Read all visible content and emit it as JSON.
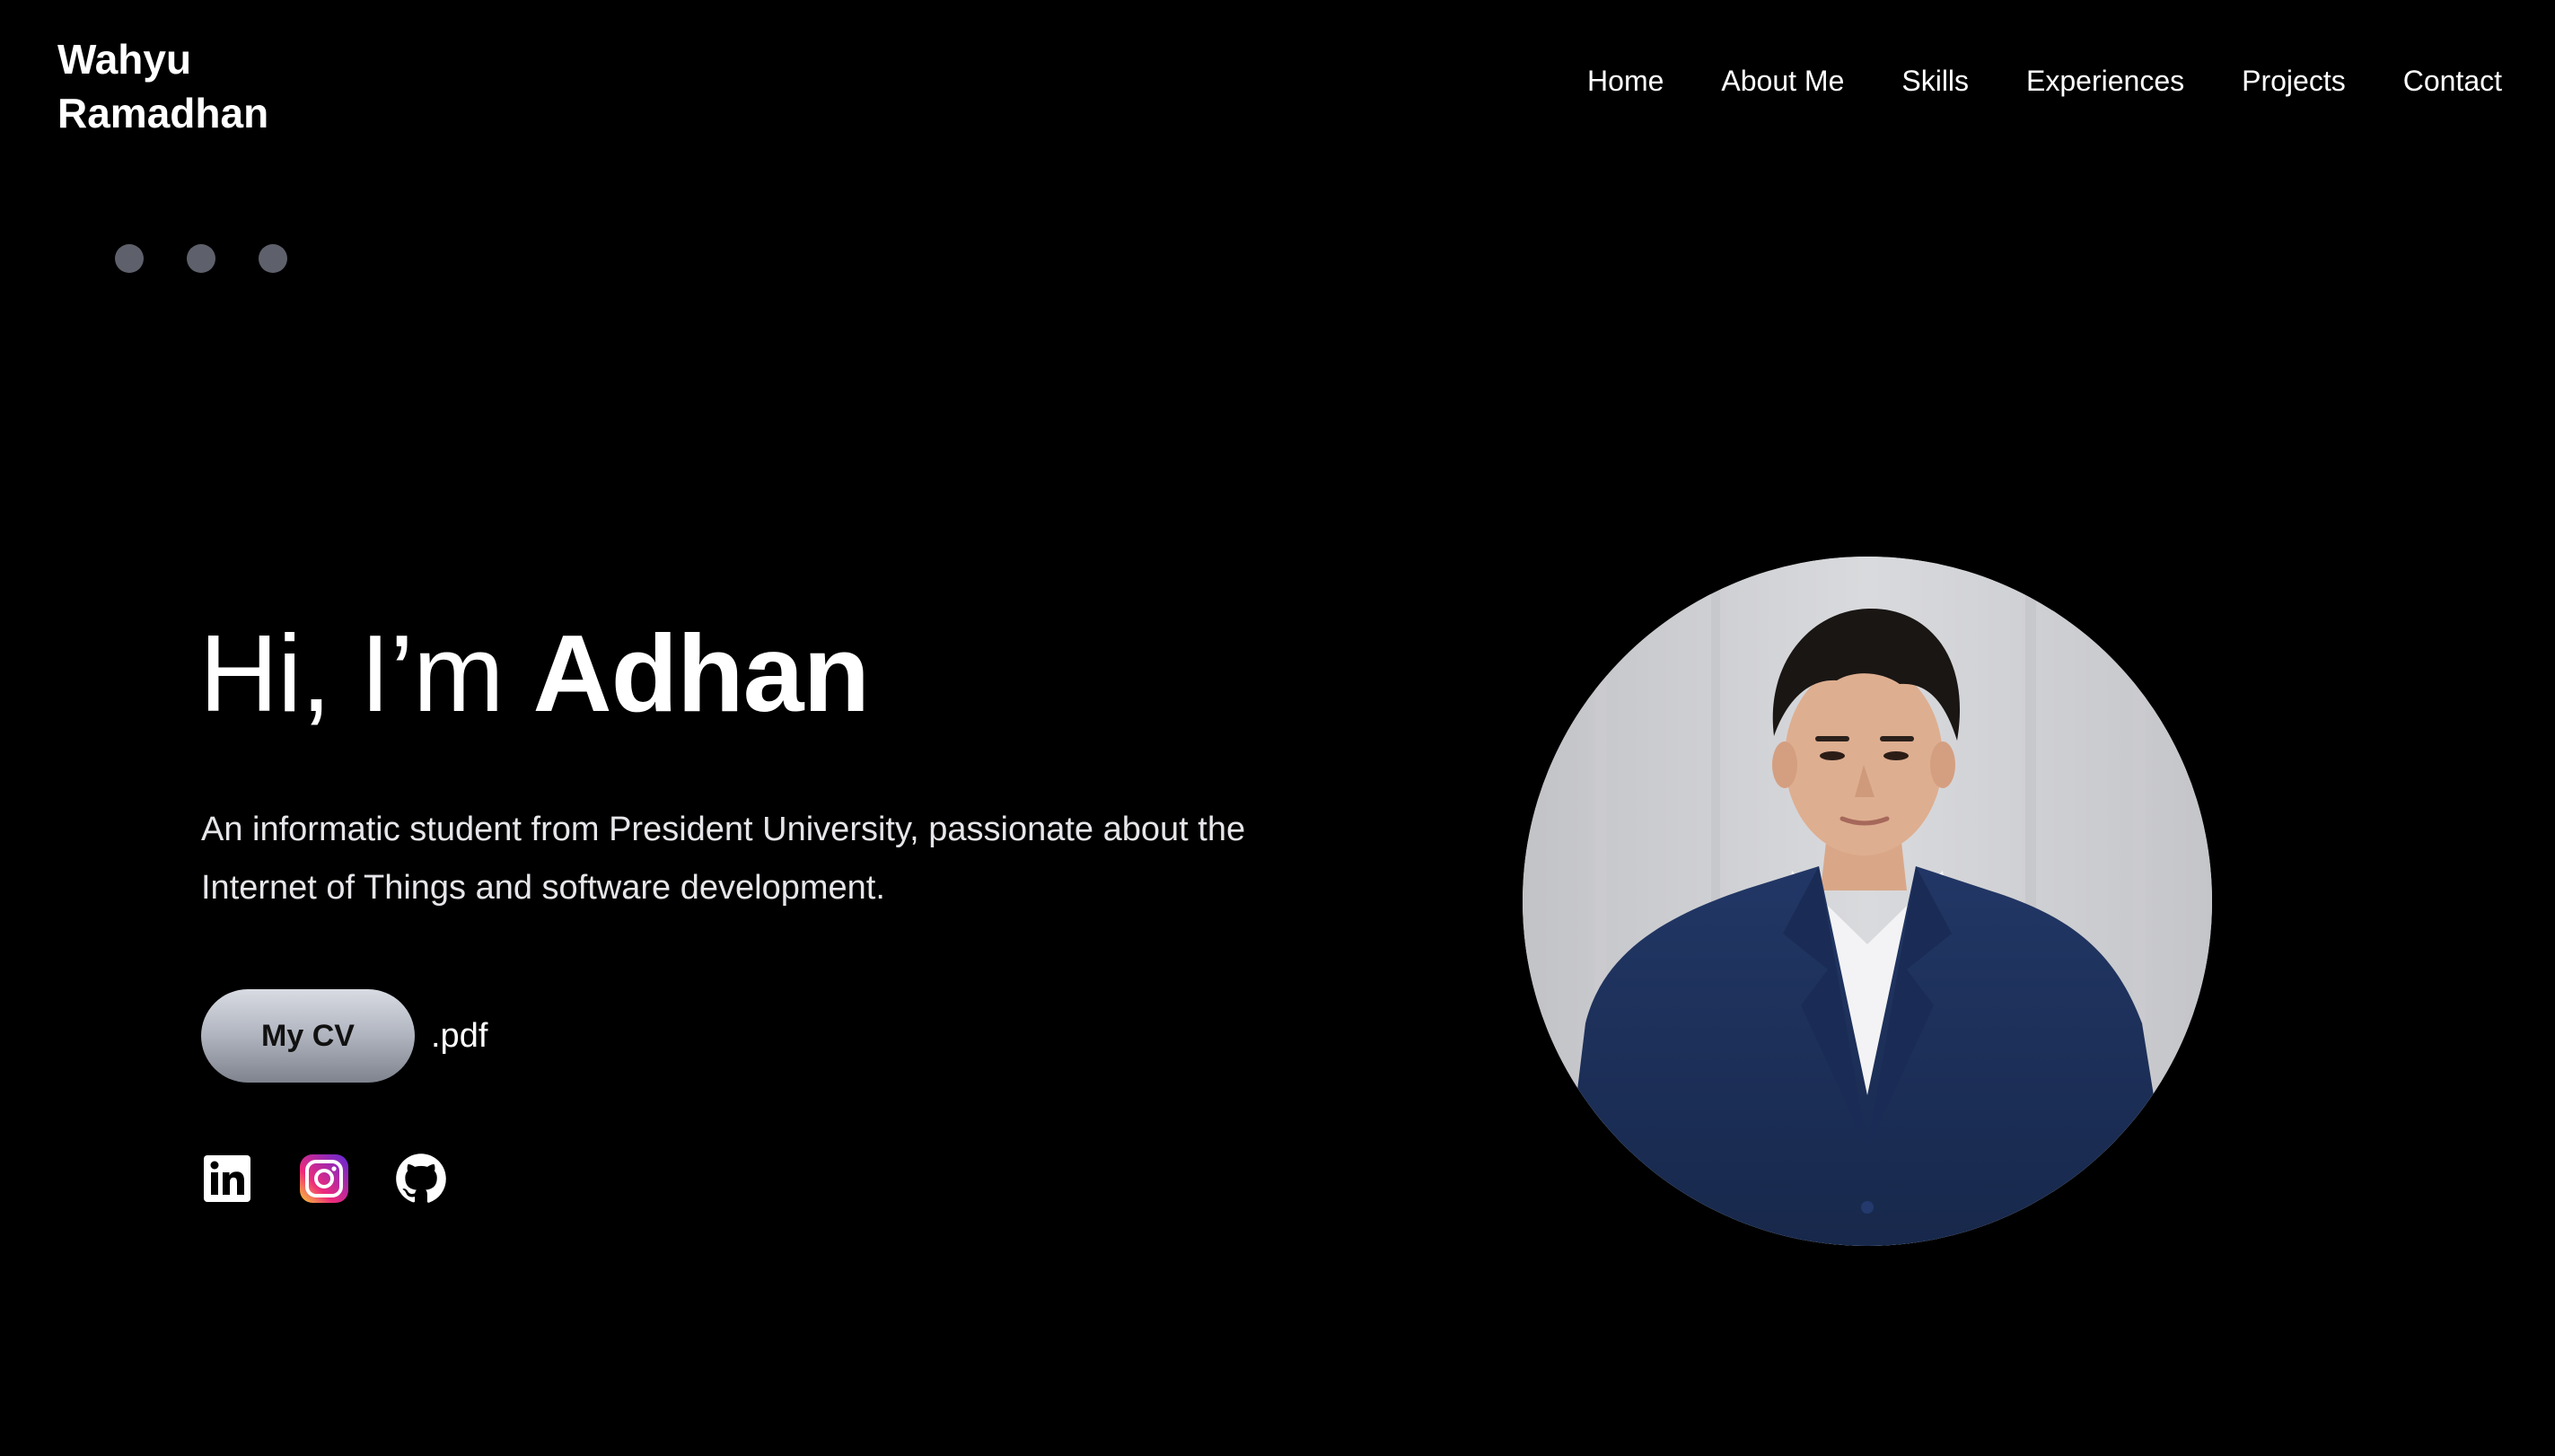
{
  "header": {
    "logo_line1": "Wahyu",
    "logo_line2": "Ramadhan",
    "nav": [
      {
        "label": "Home"
      },
      {
        "label": "About Me"
      },
      {
        "label": "Skills"
      },
      {
        "label": "Experiences"
      },
      {
        "label": "Projects"
      },
      {
        "label": "Contact"
      }
    ]
  },
  "carousel": {
    "dot_count": 3,
    "dot_color": "#5e616b"
  },
  "hero": {
    "greeting": "Hi, I’m ",
    "name": "Adhan",
    "description": "An informatic student from President University, passionate about the Internet of Things and software development.",
    "cv_button": "My CV",
    "cv_ext": ".pdf",
    "socials": [
      {
        "icon": "linkedin-icon"
      },
      {
        "icon": "instagram-icon"
      },
      {
        "icon": "github-icon"
      }
    ]
  },
  "colors": {
    "background": "#000000",
    "text": "#ffffff",
    "button_gradient_top": "#d8dbe2",
    "button_gradient_bottom": "#7f838e",
    "suit": "#1c2f57"
  }
}
